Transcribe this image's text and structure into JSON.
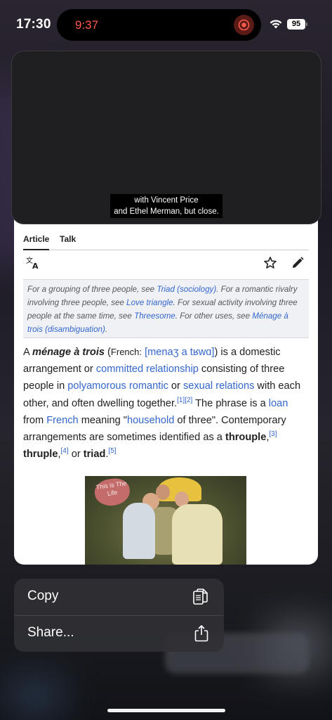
{
  "status_bar": {
    "time": "17:30",
    "battery": "95",
    "wifi_icon": "wifi-icon"
  },
  "dynamic_island": {
    "timer": "9:37",
    "recording_icon": "screen-record-icon",
    "accent_color": "#ff5a4e"
  },
  "video_preview": {
    "caption_line1": "with Vincent Price",
    "caption_line2": "and Ethel Merman, but close."
  },
  "article": {
    "tabs": [
      "Article",
      "Talk"
    ],
    "tools": {
      "language_icon": "translate-icon",
      "watch_icon": "star-icon",
      "edit_icon": "pencil-icon"
    },
    "hatnote": {
      "t1": "For a grouping of three people, see ",
      "l1": "Triad (sociology)",
      "t2": ". For a romantic rivalry involving three people, see ",
      "l2": "Love triangle",
      "t3": ". For sexual activity involving three people at the same time, see ",
      "l3": "Threesome",
      "t4": ". For other uses, see ",
      "l4": "Ménage à trois (disambiguation)",
      "t5": "."
    },
    "lead": {
      "a": "A ",
      "term": "ménage à trois",
      "b": " (",
      "french": "French:",
      "c": " ",
      "ipa": "[menaʒ a tʁwɑ]",
      "d": ") is a domestic arrangement or ",
      "l_committed": "committed relationship",
      "e": " consisting of three people in ",
      "l_poly": "polyamorous romantic",
      "f": " or ",
      "l_sexual": "sexual relations",
      "g": " with each other, and often dwelling together.",
      "ref1": "[1]",
      "ref2": "[2]",
      "h": " The phrase is a ",
      "l_loan": "loan",
      "i": " from ",
      "l_french": "French",
      "j": " meaning \"",
      "l_household": "household",
      "k": " of three\". Contemporary arrangements are sometimes identified as a ",
      "throuple": "throuple",
      "comma": ",",
      "ref3": "[3]",
      "thruple": "thruple",
      "comma2": ",",
      "ref4": "[4]",
      "or": " or ",
      "triad": "triad",
      "dot": ".",
      "ref5": "[5]"
    },
    "image_caption_art": "This is The Life"
  },
  "context_menu": {
    "items": [
      {
        "label": "Copy",
        "icon": "copy-icon"
      },
      {
        "label": "Share...",
        "icon": "share-icon"
      }
    ]
  },
  "colors": {
    "link": "#3366cc",
    "menu_bg": "#303034"
  }
}
